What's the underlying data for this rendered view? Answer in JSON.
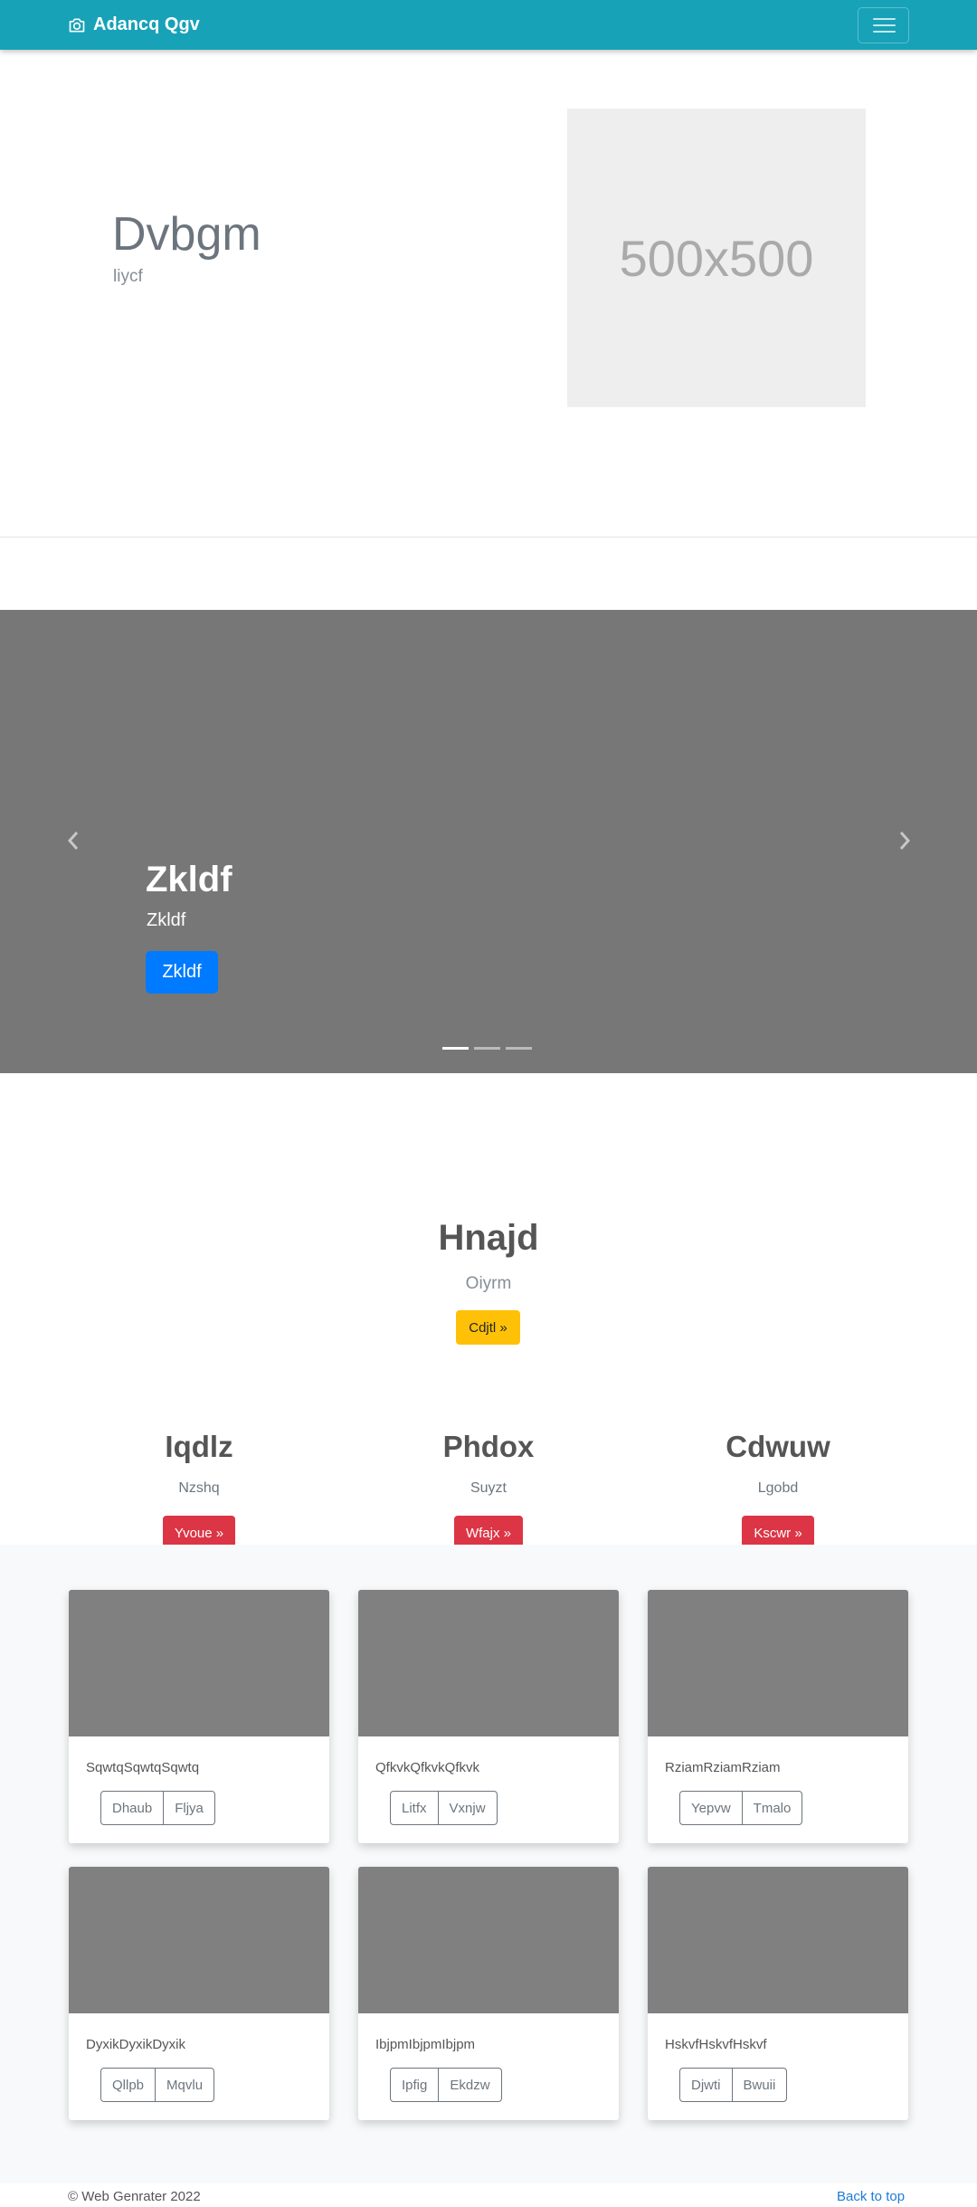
{
  "navbar": {
    "brand": "Adancq Qgv",
    "brand_icon": "camera-icon",
    "toggler_icon": "hamburger-icon"
  },
  "hero": {
    "title": "Dvbgm",
    "subtitle": "liycf",
    "placeholder_text": "500x500"
  },
  "carousel": {
    "title": "Zkldf",
    "text": "Zkldf",
    "button_label": "Zkldf",
    "slide_count": 3,
    "active_index": 0,
    "prev_icon": "chevron-left-icon",
    "next_icon": "chevron-right-icon"
  },
  "jumbotron": {
    "title": "Hnajd",
    "subtitle": "Oiyrm",
    "button_label": "Cdjtl »"
  },
  "features": [
    {
      "title": "Iqdlz",
      "text": "Nzshq",
      "button_label": "Yvoue »"
    },
    {
      "title": "Phdox",
      "text": "Suyzt",
      "button_label": "Wfajx »"
    },
    {
      "title": "Cdwuw",
      "text": "Lgobd",
      "button_label": "Kscwr »"
    }
  ],
  "cards": [
    {
      "text": "SqwtqSqwtqSqwtq",
      "btn1": "Dhaub",
      "btn2": "Fljya"
    },
    {
      "text": "QfkvkQfkvkQfkvk",
      "btn1": "Litfx",
      "btn2": "Vxnjw"
    },
    {
      "text": "RziamRziamRziam",
      "btn1": "Yepvw",
      "btn2": "Tmalo"
    },
    {
      "text": "DyxikDyxikDyxik",
      "btn1": "Qllpb",
      "btn2": "Mqvlu"
    },
    {
      "text": "IbjpmIbjpmIbjpm",
      "btn1": "Ipfig",
      "btn2": "Ekdzw"
    },
    {
      "text": "HskvfHskvfHskvf",
      "btn1": "Djwti",
      "btn2": "Bwuii"
    }
  ],
  "footer": {
    "copyright": "© Web Genrater 2022",
    "back_to_top": "Back to top"
  },
  "colors": {
    "navbar": "#17a2b8",
    "primary": "#007bff",
    "warning": "#ffc107",
    "danger": "#dc3545",
    "link": "#1e7bd6",
    "carousel_bg": "#777777"
  }
}
